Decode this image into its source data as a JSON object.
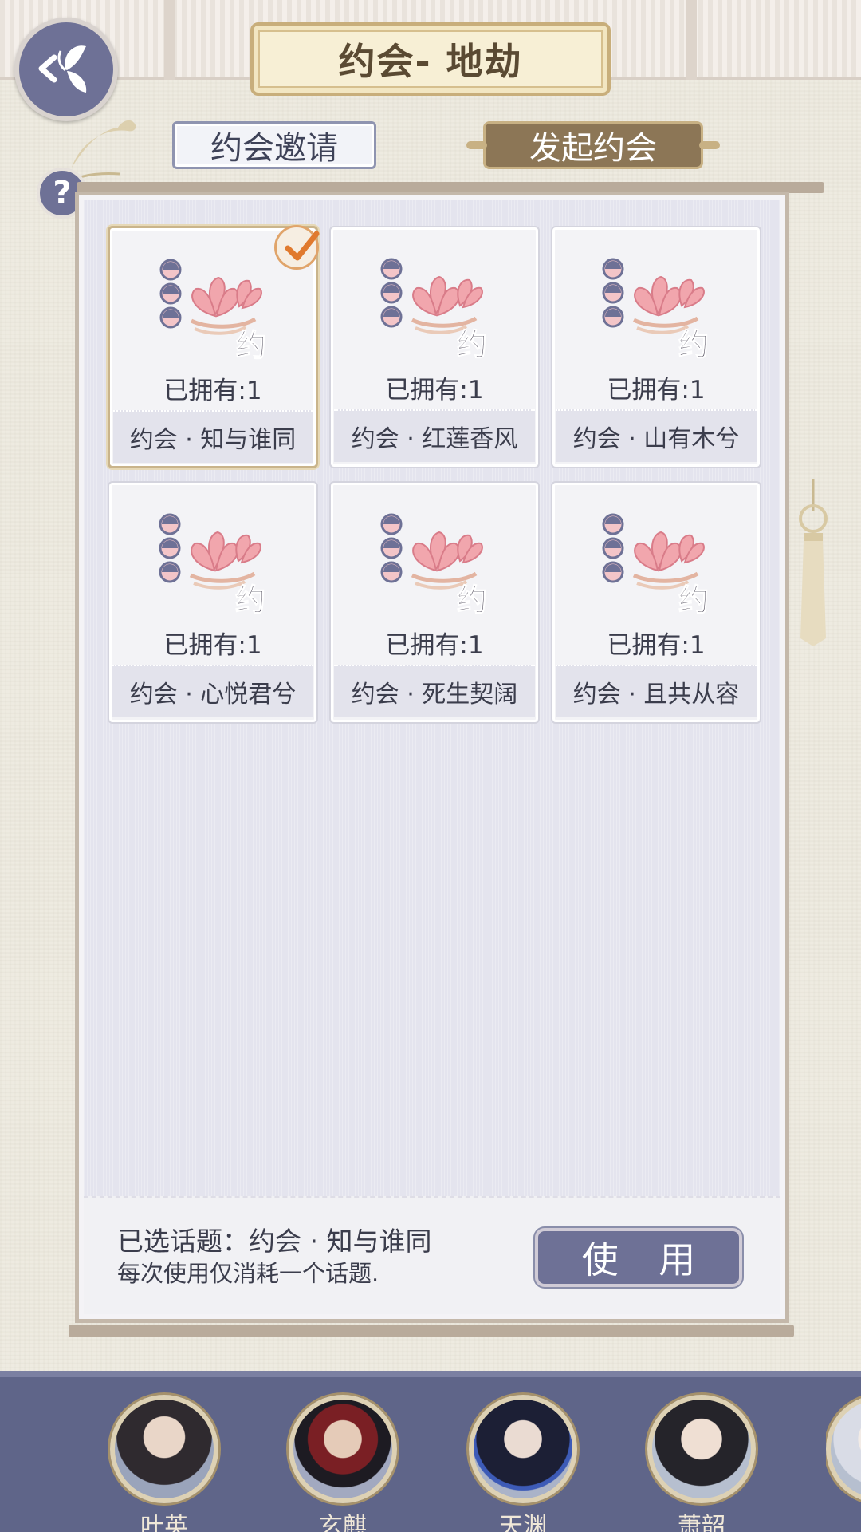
{
  "header": {
    "title": "约会- 地劫"
  },
  "tabs": {
    "invite_label": "约会邀请",
    "start_label": "发起约会"
  },
  "help": {
    "label": "?"
  },
  "cards": [
    {
      "owned": "已拥有:1",
      "name": "约会 · 知与谁同",
      "selected": true
    },
    {
      "owned": "已拥有:1",
      "name": "约会 · 红莲香风",
      "selected": false
    },
    {
      "owned": "已拥有:1",
      "name": "约会 · 山有木兮",
      "selected": false
    },
    {
      "owned": "已拥有:1",
      "name": "约会 · 心悦君兮",
      "selected": false
    },
    {
      "owned": "已拥有:1",
      "name": "约会 · 死生契阔",
      "selected": false
    },
    {
      "owned": "已拥有:1",
      "name": "约会 · 且共从容",
      "selected": false
    }
  ],
  "card_icon_char": "约",
  "footer": {
    "selected_topic": "已选话题：约会 · 知与谁同",
    "consume_note": "每次使用仅消耗一个话题.",
    "use_label": "使 用"
  },
  "characters": [
    {
      "name": "叶英"
    },
    {
      "name": "玄麒"
    },
    {
      "name": "天渊"
    },
    {
      "name": "萧韶"
    }
  ],
  "colors": {
    "accent_purple": "#6e7196",
    "gold_border": "#c8ae7b",
    "tab_active": "#8c7656",
    "char_bar": "#5f6589"
  }
}
